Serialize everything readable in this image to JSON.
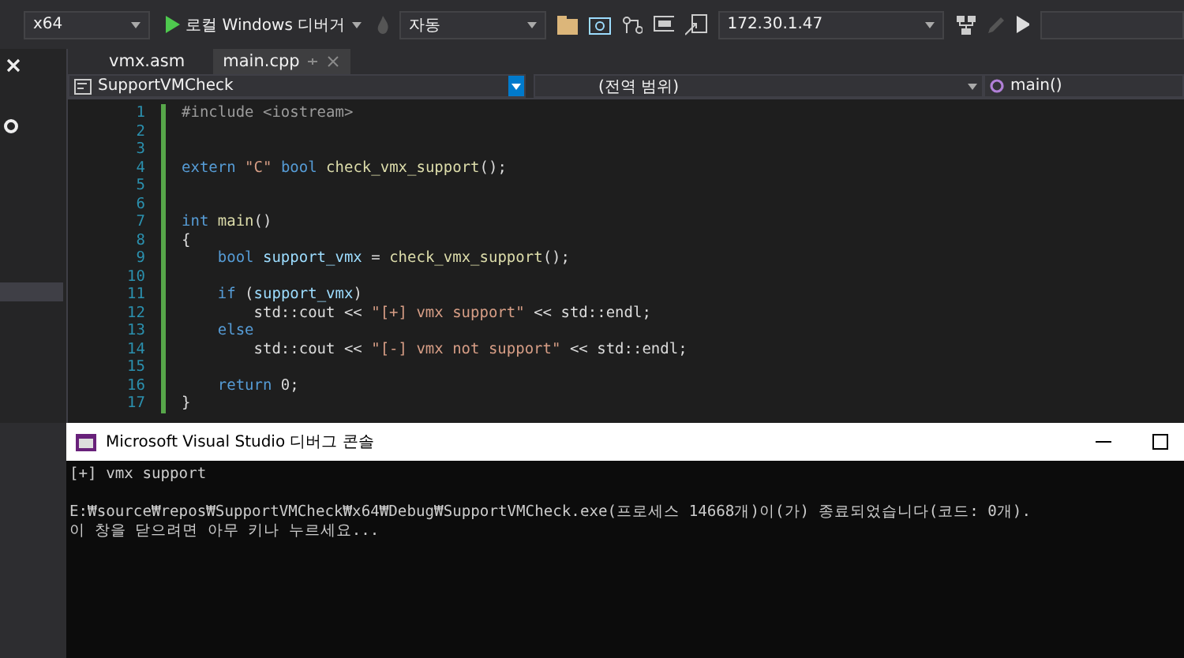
{
  "toolbar": {
    "platform": "x64",
    "run_label": "로컬 Windows 디버거",
    "config": "자동",
    "remote_address": "172.30.1.47"
  },
  "tabs": [
    {
      "label": "vmx.asm",
      "selected": false
    },
    {
      "label": "main.cpp",
      "selected": true
    }
  ],
  "navigation": {
    "project": "SupportVMCheck",
    "scope": "(전역 범위)",
    "member": "main()"
  },
  "code_lines": [
    {
      "number": "1",
      "tokens": [
        {
          "text": "#include <iostream>",
          "kind": "preproc"
        }
      ]
    },
    {
      "number": "2"
    },
    {
      "number": "3"
    },
    {
      "number": "4",
      "tokens": [
        {
          "text": "extern ",
          "kind": "keyword"
        },
        {
          "text": "\"C\" ",
          "kind": "string"
        },
        {
          "text": "bool ",
          "kind": "keyword"
        },
        {
          "text": "check_vmx_support",
          "kind": "func"
        },
        {
          "text": "();",
          "kind": "plain"
        }
      ]
    },
    {
      "number": "5"
    },
    {
      "number": "6"
    },
    {
      "number": "7",
      "tokens": [
        {
          "text": "int ",
          "kind": "keyword"
        },
        {
          "text": "main",
          "kind": "func"
        },
        {
          "text": "()",
          "kind": "plain"
        }
      ]
    },
    {
      "number": "8",
      "tokens": [
        {
          "text": "{",
          "kind": "plain"
        }
      ]
    },
    {
      "number": "9",
      "tokens": [
        {
          "text": "    bool ",
          "kind": "keyword"
        },
        {
          "text": "support_vmx",
          "kind": "var"
        },
        {
          "text": " = ",
          "kind": "plain"
        },
        {
          "text": "check_vmx_support",
          "kind": "func"
        },
        {
          "text": "();",
          "kind": "plain"
        }
      ]
    },
    {
      "number": "10"
    },
    {
      "number": "11",
      "tokens": [
        {
          "text": "    if ",
          "kind": "keyword"
        },
        {
          "text": "(",
          "kind": "plain"
        },
        {
          "text": "support_vmx",
          "kind": "var"
        },
        {
          "text": ")",
          "kind": "plain"
        }
      ]
    },
    {
      "number": "12",
      "tokens": [
        {
          "text": "        std::cout << ",
          "kind": "plain"
        },
        {
          "text": "\"[+] vmx support\"",
          "kind": "string"
        },
        {
          "text": " << std::endl;",
          "kind": "plain"
        }
      ]
    },
    {
      "number": "13",
      "tokens": [
        {
          "text": "    else",
          "kind": "keyword"
        }
      ]
    },
    {
      "number": "14",
      "tokens": [
        {
          "text": "        std::cout << ",
          "kind": "plain"
        },
        {
          "text": "\"[-] vmx not support\"",
          "kind": "string"
        },
        {
          "text": " << std::endl;",
          "kind": "plain"
        }
      ]
    },
    {
      "number": "15"
    },
    {
      "number": "16",
      "tokens": [
        {
          "text": "    return ",
          "kind": "keyword"
        },
        {
          "text": "0;",
          "kind": "plain"
        }
      ]
    },
    {
      "number": "17",
      "tokens": [
        {
          "text": "}",
          "kind": "plain"
        }
      ]
    }
  ],
  "console": {
    "title": "Microsoft Visual Studio 디버그 콘솔",
    "output": [
      "[+] vmx support"
    ],
    "exit_lines": [
      "E:₩source₩repos₩SupportVMCheck₩x64₩Debug₩SupportVMCheck.exe(프로세스 14668개)이(가) 종료되었습니다(코드: 0개).",
      "이 창을 닫으려면 아무 키나 누르세요..."
    ]
  }
}
